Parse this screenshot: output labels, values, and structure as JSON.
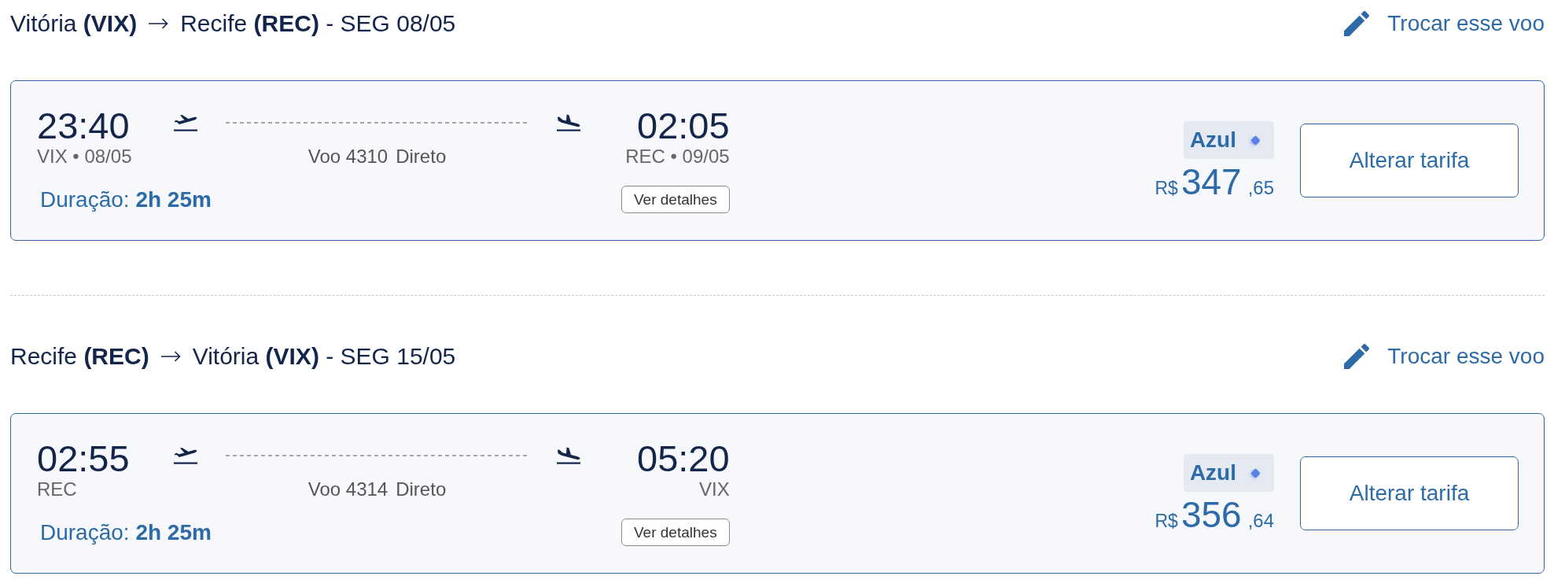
{
  "legs": [
    {
      "header": {
        "origin": "Vitória **(VIX)**",
        "destination": "Recife **(REC)** - SEG 08/05",
        "change_link": "Trocar esse voo"
      },
      "flight": {
        "departure": {
          "time": "23:40",
          "place": "VIX • 08/05"
        },
        "arrival": {
          "time": "02:05",
          "place": "REC • 09/05"
        },
        "flight_number": "Voo 4310",
        "stops": "Direto",
        "duration": "Duração: **2h 25m**",
        "details_button": "Ver detalhes",
        "fare": {
          "brand": "Azul",
          "currency": "R$",
          "amount": "347",
          "cents": ",65"
        },
        "change_fare_button": "Alterar tarifa"
      }
    },
    {
      "header": {
        "origin": "Recife **(REC)**",
        "destination": "Vitória **(VIX)** - SEG 15/05",
        "change_link": "Trocar esse voo"
      },
      "flight": {
        "departure": {
          "time": "02:55",
          "place": "REC"
        },
        "arrival": {
          "time": "05:20",
          "place": "VIX"
        },
        "flight_number": "Voo 4314",
        "stops": "Direto",
        "duration": "Duração: **2h 25m**",
        "details_button": "Ver detalhes",
        "fare": {
          "brand": "Azul",
          "currency": "R$",
          "amount": "356",
          "cents": ",64"
        },
        "change_fare_button": "Alterar tarifa"
      }
    }
  ]
}
